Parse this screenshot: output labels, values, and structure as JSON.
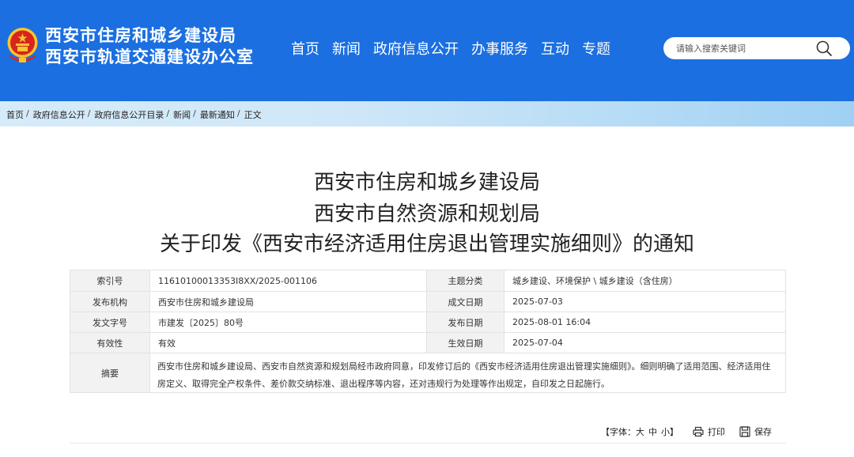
{
  "header": {
    "org_line1": "西安市住房和城乡建设局",
    "org_line2": "西安市轨道交通建设办公室",
    "nav": [
      "首页",
      "新闻",
      "政府信息公开",
      "办事服务",
      "互动",
      "专题"
    ],
    "search": {
      "placeholder": "请输入搜索关键词",
      "icon": "search-icon"
    },
    "colors": {
      "header_bg": "#1b6fe0",
      "emblem_red": "#d7261d",
      "emblem_gold": "#f7c531"
    }
  },
  "breadcrumb": [
    "首页",
    "政府信息公开",
    "政府信息公开目录",
    "新闻",
    "最新通知",
    "正文"
  ],
  "breadcrumb_sep": "/",
  "article": {
    "title_lines": [
      "西安市住房和城乡建设局",
      "西安市自然资源和规划局",
      "关于印发《西安市经济适用住房退出管理实施细则》的通知"
    ]
  },
  "meta": {
    "index_no_label": "索引号",
    "index_no": "11610100013353I8XX/2025-001106",
    "topic_label": "主题分类",
    "topic": "城乡建设、环境保护 \\ 城乡建设（含住房）",
    "publisher_label": "发布机构",
    "publisher": "西安市住房和城乡建设局",
    "created_label": "成文日期",
    "created": "2025-07-03",
    "doc_no_label": "发文字号",
    "doc_no": "市建发〔2025〕80号",
    "published_label": "发布日期",
    "published": "2025-08-01 16:04",
    "validity_label": "有效性",
    "validity": "有效",
    "effective_label": "生效日期",
    "effective": "2025-07-04",
    "abstract_label": "摘要",
    "abstract": "西安市住房和城乡建设局、西安市自然资源和规划局经市政府同意，印发修订后的《西安市经济适用住房退出管理实施细则》。细则明确了适用范围、经济适用住房定义、取得完全产权条件、差价款交纳标准、退出程序等内容，还对违规行为处理等作出规定，自印发之日起施行。"
  },
  "tools": {
    "font_prefix": "【字体：",
    "font_large": "大",
    "font_medium": "中",
    "font_small": "小",
    "font_suffix": "】",
    "print_label": "打印",
    "print_icon": "printer-icon",
    "save_label": "保存",
    "save_icon": "save-icon"
  }
}
